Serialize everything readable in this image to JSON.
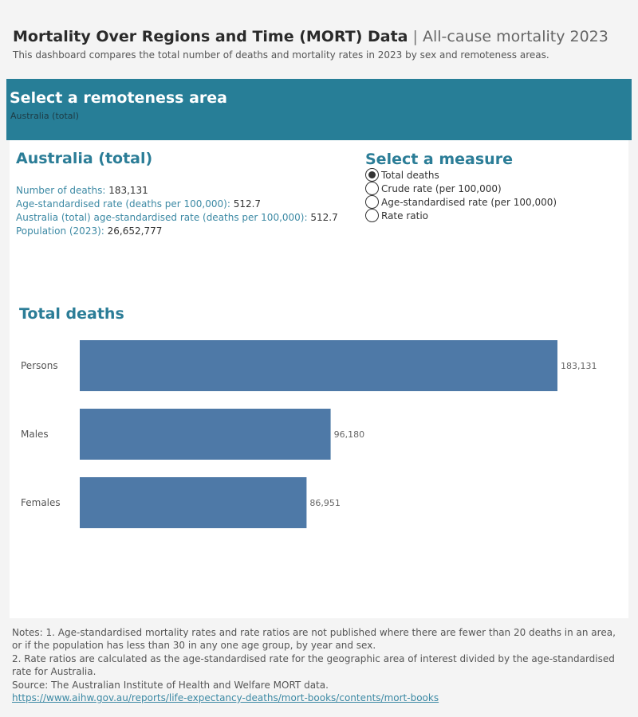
{
  "header": {
    "title_main": "Mortality Over Regions and Time (MORT) Data",
    "title_sep": " | ",
    "title_sub": "All-cause mortality 2023",
    "subtitle": "This dashboard compares the total number of deaths and mortality rates in 2023 by sex and remoteness areas."
  },
  "region_selector": {
    "heading": "Select a remoteness area",
    "selected": "Australia (total)"
  },
  "area": {
    "title": "Australia (total)",
    "stats": [
      {
        "label": "Number of deaths:",
        "value": "183,131"
      },
      {
        "label": "Age-standardised rate (deaths per 100,000):",
        "value": "512.7"
      },
      {
        "label": "Australia (total) age-standardised rate (deaths per 100,000):",
        "value": "512.7"
      },
      {
        "label": "Population (2023):",
        "value": "26,652,777"
      }
    ]
  },
  "measure_selector": {
    "title": "Select a measure",
    "options": [
      {
        "label": "Total deaths",
        "selected": true
      },
      {
        "label": "Crude rate (per 100,000)",
        "selected": false
      },
      {
        "label": "Age-standardised rate (per 100,000)",
        "selected": false
      },
      {
        "label": "Rate ratio",
        "selected": false
      }
    ]
  },
  "chart_data": {
    "type": "bar",
    "orientation": "horizontal",
    "title": "Total deaths",
    "categories": [
      "Persons",
      "Males",
      "Females"
    ],
    "values": [
      183131,
      96180,
      86951
    ],
    "value_labels": [
      "183,131",
      "96,180",
      "86,951"
    ],
    "bar_color": "#4e79a7",
    "grid": false,
    "xlabel": "",
    "ylabel": ""
  },
  "notes": {
    "lines": [
      "Notes: 1. Age-standardised mortality rates and rate ratios are not published where there are fewer than 20 deaths in an area, or if the population has less than 30 in any one age group, by year and sex.",
      "2. Rate ratios are calculated as the age-standardised rate for the geographic area of interest divided by the age-standardised rate for Australia.",
      "Source: The Australian Institute of Health and Welfare MORT data."
    ],
    "link": "https://www.aihw.gov.au/reports/life-expectancy-deaths/mort-books/contents/mort-books"
  },
  "colors": {
    "accent": "#277e97",
    "heading": "#2b7d97",
    "label": "#3c89a4",
    "bar": "#4e79a7"
  }
}
